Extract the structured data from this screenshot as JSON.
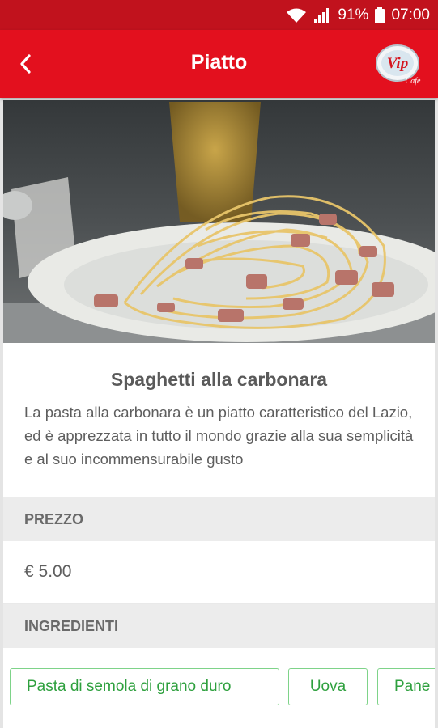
{
  "status_bar": {
    "battery": "91%",
    "time": "07:00"
  },
  "app_bar": {
    "title": "Piatto",
    "logo_text": "Vip",
    "logo_subtext": "Café"
  },
  "dish": {
    "name": "Spaghetti alla carbonara",
    "description": "La pasta alla carbonara è un piatto caratteristico del Lazio, ed è apprezzata in tutto il mondo grazie alla sua semplicità e al suo incommensurabile gusto"
  },
  "sections": {
    "price_header": "PREZZO",
    "ingredients_header": "INGREDIENTI"
  },
  "price": "€ 5.00",
  "ingredients": [
    "Pasta di semola di grano duro",
    "Uova",
    "Pane"
  ],
  "colors": {
    "primary": "#e3101e",
    "status_bar": "#c1121d",
    "chip": "#2ea03e"
  }
}
